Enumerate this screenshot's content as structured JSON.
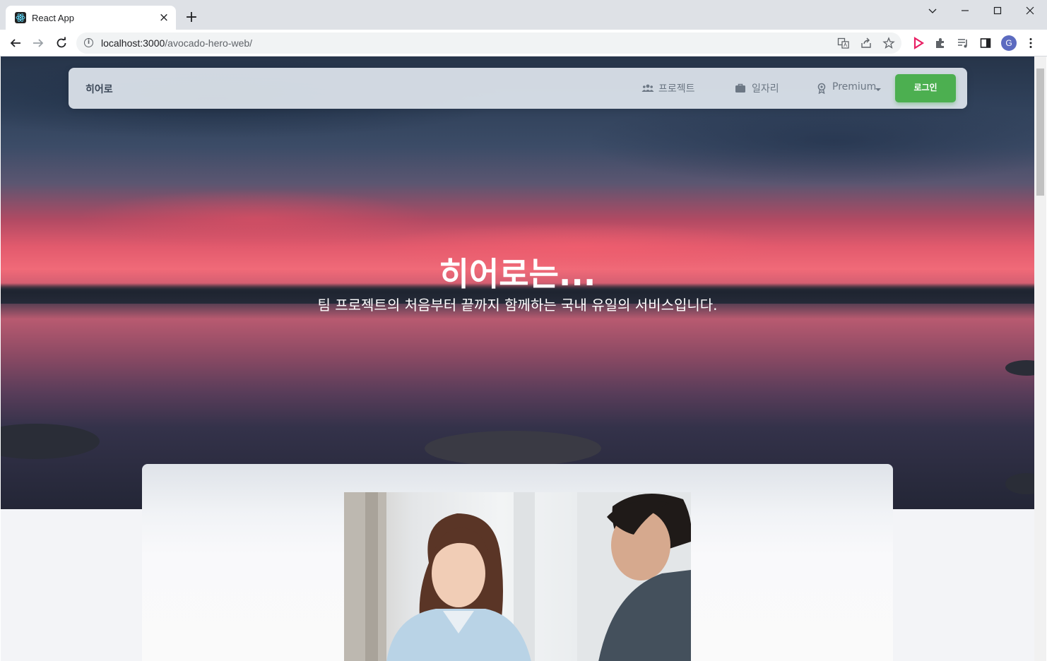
{
  "browser": {
    "tab_title": "React App",
    "tab_close": "×",
    "new_tab": "+",
    "url_host": "localhost:3000",
    "url_path": "/avocado-hero-web/",
    "profile_initial": "G"
  },
  "navbar": {
    "brand": "히어로",
    "items": [
      {
        "label": "프로젝트",
        "icon": "people-icon"
      },
      {
        "label": "일자리",
        "icon": "briefcase-icon"
      },
      {
        "label": "Premium",
        "icon": "badge-icon"
      }
    ],
    "login": "로그인"
  },
  "hero": {
    "title": "히어로는...",
    "subtitle": "팀 프로젝트의 처음부터 끝까지 함께하는 국내 유일의 서비스입니다."
  },
  "colors": {
    "accent": "#4caf50",
    "sky_top": "#263449",
    "sunset": "#f06a78"
  }
}
